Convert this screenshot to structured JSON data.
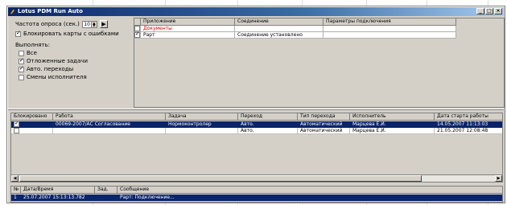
{
  "window": {
    "title": "Lotus PDM Run Auto"
  },
  "settings": {
    "poll_label": "Частота опроса (сек.)",
    "poll_value": "10",
    "block_cards_label": "Блокировать карты с ошибками",
    "block_cards_checked": true,
    "perform_label": "Выполнять:",
    "options": [
      {
        "label": "Все",
        "checked": false
      },
      {
        "label": "Отложенные задачи",
        "checked": true
      },
      {
        "label": "Авто. переходы",
        "checked": true
      },
      {
        "label": "Смены исполнителя",
        "checked": false
      }
    ]
  },
  "apps_table": {
    "columns": [
      "Приложение",
      "Соединение",
      "Параметры подключения"
    ],
    "rows": [
      {
        "checked": false,
        "app": "Документы",
        "connection": "",
        "params": "",
        "color": "#cc0000"
      },
      {
        "checked": true,
        "app": "Рарт",
        "connection": "Соединение установлено",
        "params": "",
        "color": "#000000"
      }
    ]
  },
  "jobs_table": {
    "columns": [
      "Блокировано",
      "Работа",
      "Задача",
      "Переход",
      "Тип перехода",
      "Исполнитель",
      "Дата старта работы"
    ],
    "rows": [
      {
        "selected": true,
        "blocked": "",
        "job": "00069-2007/АС Согласование",
        "task": "Нормоконтролер",
        "transition": "Авто.",
        "type": "Автоматический",
        "performer": "Марцева Е.И.",
        "date": "14.05.2007 11:13:03"
      },
      {
        "selected": false,
        "blocked": "",
        "job": "",
        "task": "",
        "transition": "Авто.",
        "type": "Автоматический",
        "performer": "Марцева Е.И.",
        "date": "21.05.2007 12:08:48"
      }
    ]
  },
  "log_table": {
    "columns": [
      "№",
      "Дата/Время",
      "Зад.",
      "Сообщение"
    ],
    "rows": [
      {
        "num": "1",
        "datetime": "25.07.2007 15:13:13.782",
        "task": "",
        "message": "Рарт: Подключение..."
      }
    ]
  }
}
